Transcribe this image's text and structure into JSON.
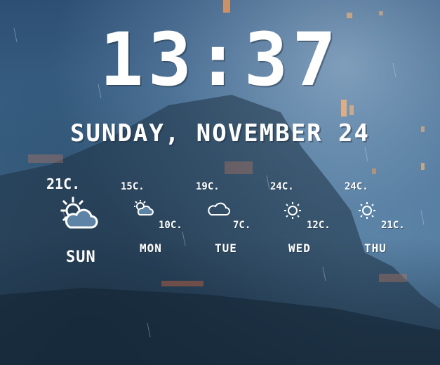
{
  "clock": {
    "time": "13:37"
  },
  "date": {
    "text": "SUNDAY, NOVEMBER 24"
  },
  "forecast": [
    {
      "high": "21C.",
      "low": "",
      "day": "SUN",
      "icon": "partly-cloudy-icon"
    },
    {
      "high": "15C.",
      "low": "10C.",
      "day": "MON",
      "icon": "partly-cloudy-icon"
    },
    {
      "high": "19C.",
      "low": "7C.",
      "day": "TUE",
      "icon": "cloud-icon"
    },
    {
      "high": "24C.",
      "low": "12C.",
      "day": "WED",
      "icon": "sun-icon"
    },
    {
      "high": "24C.",
      "low": "21C.",
      "day": "THU",
      "icon": "sun-icon"
    }
  ],
  "colors": {
    "text": "#ffffff",
    "sky_dark": "#2d4f73",
    "sky_light": "#bcd7ef"
  }
}
